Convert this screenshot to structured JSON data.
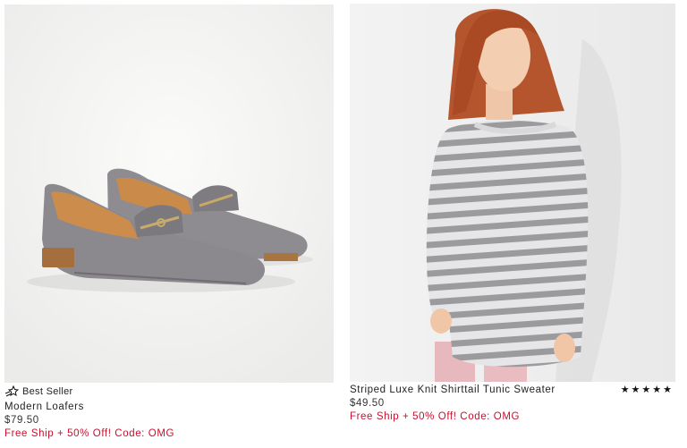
{
  "products": [
    {
      "badge": "Best Seller",
      "name": "Modern Loafers",
      "price": "$79.50",
      "promo": "Free Ship + 50% Off! Code: OMG"
    },
    {
      "name": "Striped Luxe Knit Shirttail Tunic Sweater",
      "price": "$49.50",
      "promo": "Free Ship + 50% Off! Code: OMG",
      "rating_stars": "★★★★★",
      "rating_value": 5
    }
  ],
  "colors": {
    "promo": "#c8102e",
    "shoe_grey": "#8c8a8e",
    "sweater_stripe": "#9a9a9c"
  },
  "icons": {
    "badge": "shooting-star-icon"
  }
}
